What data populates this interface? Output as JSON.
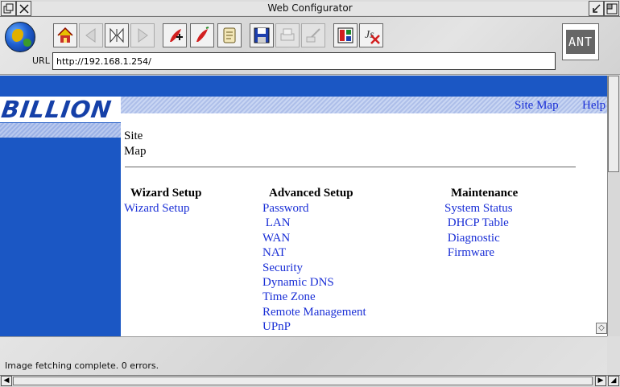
{
  "window": {
    "title": "Web Configurator"
  },
  "toolbar": {
    "url_label": "URL",
    "url_value": "http://192.168.1.254/",
    "brand_badge": "ANT",
    "icons": [
      "globe-icon",
      "home-icon",
      "back-icon",
      "stop-icon",
      "forward-icon",
      "add-hotlist-icon",
      "hotlist-icon",
      "history-icon",
      "save-icon",
      "print-icon",
      "find-icon",
      "view-source-icon",
      "cancel-fetch-icon"
    ]
  },
  "page": {
    "logo": "BILLION",
    "header_links": [
      "Site Map",
      "Help"
    ],
    "title_line1": "Site",
    "title_line2": "Map",
    "columns": [
      {
        "heading": "Wizard Setup",
        "links": [
          "Wizard Setup"
        ]
      },
      {
        "heading": "Advanced Setup",
        "links": [
          "Password",
          " LAN",
          "WAN",
          "NAT",
          "Security",
          "Dynamic DNS",
          "Time Zone",
          "Remote Management",
          "UPnP"
        ]
      },
      {
        "heading": "Maintenance",
        "links": [
          "System Status",
          " DHCP Table",
          " Diagnostic",
          " Firmware"
        ]
      }
    ],
    "colors": {
      "band": "#1b57c4",
      "link": "#1a2fd6",
      "logo": "#1540a8"
    }
  },
  "status": {
    "text": "Image fetching complete. 0 errors."
  }
}
